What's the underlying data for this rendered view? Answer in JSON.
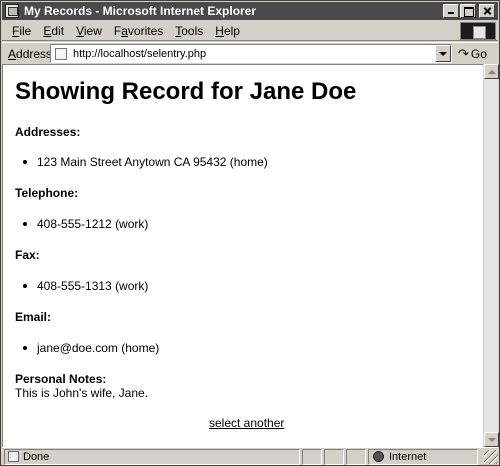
{
  "window": {
    "title": "My Records - Microsoft Internet Explorer"
  },
  "menu": {
    "items": [
      {
        "key": "F",
        "rest": "ile"
      },
      {
        "key": "E",
        "rest": "dit"
      },
      {
        "key": "V",
        "rest": "iew"
      },
      {
        "key": "",
        "pre": "F",
        "key2": "a",
        "rest": "vorites"
      },
      {
        "key": "T",
        "rest": "ools"
      },
      {
        "key": "H",
        "rest": "elp"
      }
    ]
  },
  "address": {
    "label_key": "A",
    "label_rest": "ddress",
    "url": "http://localhost/selentry.php",
    "go_label": "Go"
  },
  "page": {
    "heading": "Showing Record for Jane Doe",
    "addresses_label": "Addresses:",
    "addresses": [
      "123 Main Street Anytown CA 95432 (home)"
    ],
    "telephone_label": "Telephone:",
    "telephones": [
      "408-555-1212 (work)"
    ],
    "fax_label": "Fax:",
    "faxes": [
      "408-555-1313 (work)"
    ],
    "email_label": "Email:",
    "emails": [
      "jane@doe.com (home)"
    ],
    "notes_label": "Personal Notes:",
    "notes": "This is John's wife, Jane.",
    "select_link": "select another"
  },
  "status": {
    "text": "Done",
    "zone": "Internet"
  },
  "icons": {
    "app": "ie-app-icon",
    "logo": "windows-logo-icon",
    "page": "page-icon",
    "go": "go-arrow-icon",
    "zone": "globe-icon"
  }
}
